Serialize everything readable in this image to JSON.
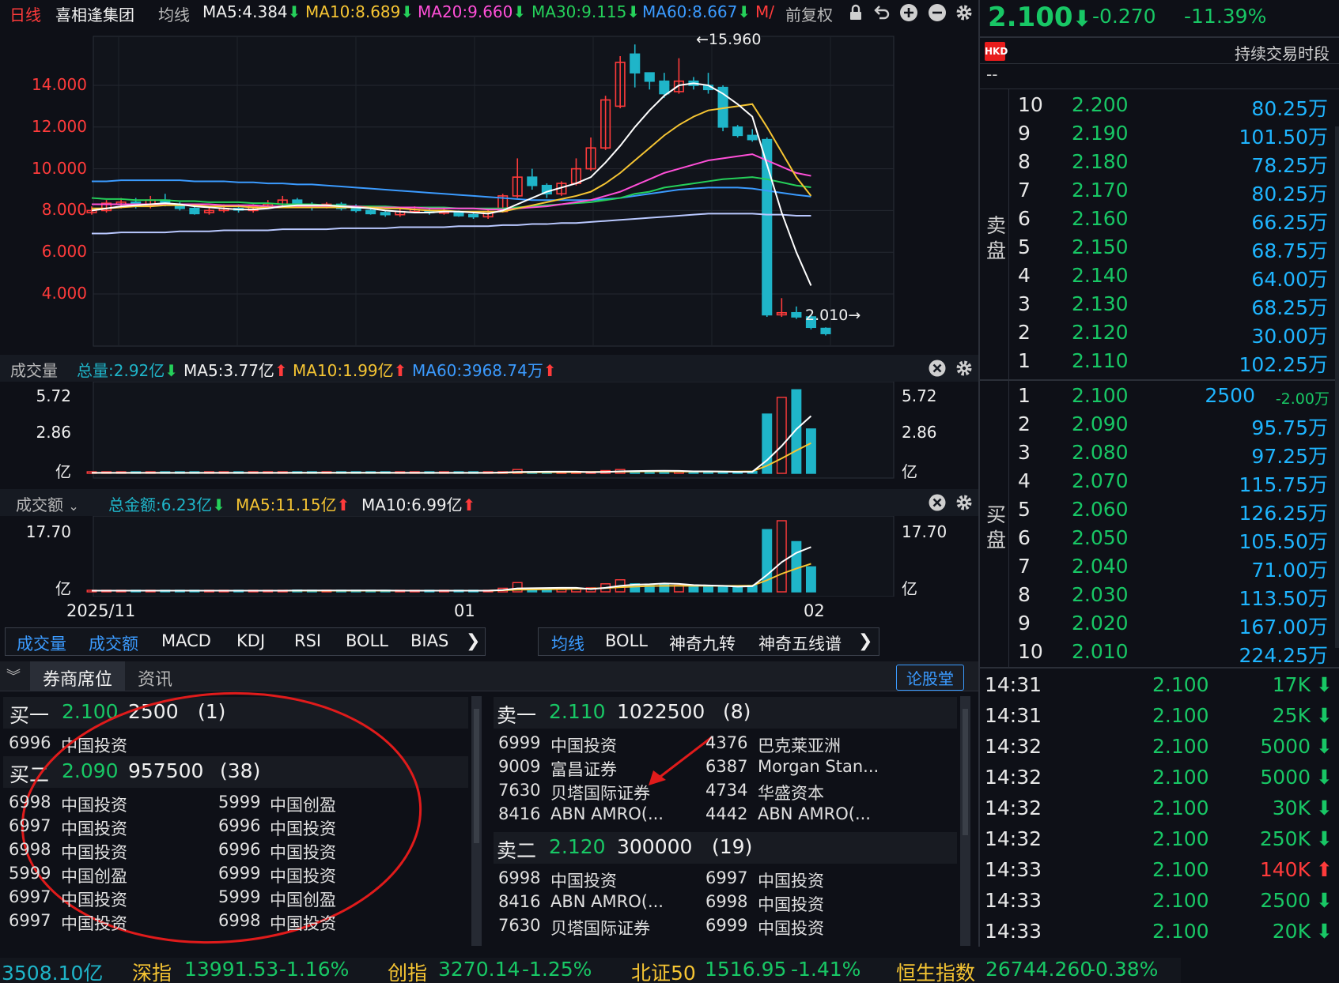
{
  "header": {
    "period": "日线",
    "stock_name": "喜相逢集团",
    "ma_label": "均线",
    "ma5": "MA5:4.384",
    "ma10": "MA10:8.689",
    "ma20": "MA20:9.660",
    "ma30": "MA30:9.115",
    "ma60": "MA60:8.667",
    "ma_more": "M/",
    "adjust": "前复权"
  },
  "quote": {
    "price": "2.100",
    "change": "-0.270",
    "change_pct": "-11.39%",
    "currency_badge": "HKD",
    "session": "持续交易时段",
    "dash": "--"
  },
  "main_chart": {
    "y_ticks": [
      "14.000",
      "12.000",
      "10.000",
      "8.000",
      "6.000",
      "4.000"
    ],
    "high_label": "←15.960",
    "low_label": "2.010→",
    "x_labels": [
      "2025/11",
      "01",
      "02"
    ]
  },
  "chart_data": {
    "type": "candlestick",
    "ylim": [
      1.5,
      16.5
    ],
    "candles": [
      {
        "o": 7.9,
        "c": 8.0,
        "h": 8.2,
        "l": 7.8
      },
      {
        "o": 8.0,
        "c": 8.35,
        "h": 8.5,
        "l": 7.9
      },
      {
        "o": 8.3,
        "c": 8.4,
        "h": 8.6,
        "l": 8.1
      },
      {
        "o": 8.4,
        "c": 8.25,
        "h": 8.6,
        "l": 8.1
      },
      {
        "o": 8.25,
        "c": 8.5,
        "h": 8.7,
        "l": 8.1
      },
      {
        "o": 8.5,
        "c": 8.3,
        "h": 8.8,
        "l": 8.2
      },
      {
        "o": 8.3,
        "c": 8.1,
        "h": 8.4,
        "l": 8.0
      },
      {
        "o": 8.1,
        "c": 7.85,
        "h": 8.2,
        "l": 7.8
      },
      {
        "o": 7.9,
        "c": 8.0,
        "h": 8.2,
        "l": 7.8
      },
      {
        "o": 8.0,
        "c": 8.1,
        "h": 8.3,
        "l": 7.9
      },
      {
        "o": 8.1,
        "c": 8.05,
        "h": 8.3,
        "l": 7.9
      },
      {
        "o": 8.0,
        "c": 8.2,
        "h": 8.3,
        "l": 7.9
      },
      {
        "o": 8.2,
        "c": 8.3,
        "h": 8.5,
        "l": 8.1
      },
      {
        "o": 8.3,
        "c": 8.5,
        "h": 8.7,
        "l": 8.2
      },
      {
        "o": 8.5,
        "c": 8.25,
        "h": 8.6,
        "l": 8.2
      },
      {
        "o": 8.25,
        "c": 8.15,
        "h": 8.4,
        "l": 8.0
      },
      {
        "o": 8.15,
        "c": 8.3,
        "h": 8.4,
        "l": 8.1
      },
      {
        "o": 8.3,
        "c": 8.1,
        "h": 8.4,
        "l": 8.0
      },
      {
        "o": 8.1,
        "c": 8.0,
        "h": 8.3,
        "l": 7.9
      },
      {
        "o": 8.0,
        "c": 7.85,
        "h": 8.1,
        "l": 7.8
      },
      {
        "o": 7.9,
        "c": 7.8,
        "h": 8.0,
        "l": 7.7
      },
      {
        "o": 7.8,
        "c": 7.95,
        "h": 8.1,
        "l": 7.7
      },
      {
        "o": 7.95,
        "c": 8.05,
        "h": 8.2,
        "l": 7.9
      },
      {
        "o": 8.0,
        "c": 7.9,
        "h": 8.1,
        "l": 7.8
      },
      {
        "o": 7.9,
        "c": 7.95,
        "h": 8.1,
        "l": 7.8
      },
      {
        "o": 7.95,
        "c": 7.75,
        "h": 8.0,
        "l": 7.7
      },
      {
        "o": 7.8,
        "c": 7.7,
        "h": 7.9,
        "l": 7.6
      },
      {
        "o": 7.7,
        "c": 7.95,
        "h": 8.1,
        "l": 7.6
      },
      {
        "o": 7.95,
        "c": 8.7,
        "h": 8.8,
        "l": 7.9
      },
      {
        "o": 8.7,
        "c": 9.6,
        "h": 10.5,
        "l": 8.6
      },
      {
        "o": 9.6,
        "c": 9.2,
        "h": 10.0,
        "l": 9.0
      },
      {
        "o": 9.2,
        "c": 8.8,
        "h": 9.3,
        "l": 8.6
      },
      {
        "o": 8.8,
        "c": 9.3,
        "h": 9.4,
        "l": 8.7
      },
      {
        "o": 9.3,
        "c": 10.0,
        "h": 10.5,
        "l": 9.2
      },
      {
        "o": 10.0,
        "c": 11.0,
        "h": 11.5,
        "l": 9.9
      },
      {
        "o": 11.0,
        "c": 13.3,
        "h": 13.5,
        "l": 10.9
      },
      {
        "o": 13.0,
        "c": 15.1,
        "h": 15.4,
        "l": 12.9
      },
      {
        "o": 15.5,
        "c": 14.6,
        "h": 15.96,
        "l": 13.9
      },
      {
        "o": 14.6,
        "c": 14.2,
        "h": 14.6,
        "l": 13.8
      },
      {
        "o": 14.2,
        "c": 13.6,
        "h": 14.6,
        "l": 13.4
      },
      {
        "o": 13.7,
        "c": 14.2,
        "h": 15.3,
        "l": 13.6
      },
      {
        "o": 14.2,
        "c": 14.0,
        "h": 14.4,
        "l": 13.8
      },
      {
        "o": 14.0,
        "c": 13.8,
        "h": 14.6,
        "l": 13.6
      },
      {
        "o": 13.9,
        "c": 12.0,
        "h": 14.0,
        "l": 11.8
      },
      {
        "o": 12.0,
        "c": 11.6,
        "h": 12.1,
        "l": 11.5
      },
      {
        "o": 11.6,
        "c": 11.4,
        "h": 11.9,
        "l": 11.3
      },
      {
        "o": 11.4,
        "c": 3.0,
        "h": 11.5,
        "l": 2.9
      },
      {
        "o": 3.0,
        "c": 3.1,
        "h": 3.8,
        "l": 2.9
      },
      {
        "o": 3.1,
        "c": 2.9,
        "h": 3.4,
        "l": 2.8
      },
      {
        "o": 2.9,
        "c": 2.4,
        "h": 3.0,
        "l": 2.3
      },
      {
        "o": 2.35,
        "c": 2.1,
        "h": 2.4,
        "l": 2.01
      }
    ],
    "ma5": [
      8.0,
      8.1,
      8.2,
      8.25,
      8.3,
      8.35,
      8.3,
      8.2,
      8.15,
      8.1,
      8.05,
      8.05,
      8.1,
      8.2,
      8.25,
      8.25,
      8.25,
      8.2,
      8.15,
      8.1,
      8.0,
      7.95,
      7.9,
      7.9,
      7.95,
      7.95,
      7.9,
      7.85,
      8.0,
      8.3,
      8.6,
      8.9,
      9.1,
      9.3,
      9.6,
      10.3,
      11.1,
      12.0,
      12.8,
      13.5,
      14.0,
      14.1,
      14.0,
      13.6,
      13.1,
      12.5,
      10.2,
      7.9,
      6.0,
      4.4
    ],
    "ma10": [
      8.1,
      8.1,
      8.15,
      8.2,
      8.2,
      8.25,
      8.25,
      8.25,
      8.2,
      8.2,
      8.2,
      8.15,
      8.15,
      8.15,
      8.15,
      8.15,
      8.15,
      8.15,
      8.15,
      8.15,
      8.1,
      8.1,
      8.05,
      8.0,
      8.0,
      7.95,
      7.95,
      7.95,
      7.95,
      8.1,
      8.25,
      8.4,
      8.55,
      8.7,
      8.9,
      9.3,
      9.8,
      10.4,
      11.0,
      11.6,
      12.1,
      12.5,
      12.8,
      12.9,
      13.0,
      13.1,
      12.0,
      10.8,
      9.6,
      8.7
    ],
    "ma20": [
      8.3,
      8.3,
      8.3,
      8.3,
      8.3,
      8.3,
      8.3,
      8.3,
      8.3,
      8.25,
      8.25,
      8.25,
      8.2,
      8.2,
      8.2,
      8.2,
      8.2,
      8.2,
      8.2,
      8.15,
      8.15,
      8.15,
      8.15,
      8.1,
      8.1,
      8.1,
      8.1,
      8.05,
      8.05,
      8.1,
      8.15,
      8.2,
      8.3,
      8.4,
      8.5,
      8.7,
      8.9,
      9.2,
      9.5,
      9.8,
      10.0,
      10.2,
      10.4,
      10.5,
      10.6,
      10.7,
      10.4,
      10.1,
      9.8,
      9.66
    ],
    "ma30": [
      8.6,
      8.55,
      8.55,
      8.5,
      8.5,
      8.5,
      8.45,
      8.45,
      8.4,
      8.4,
      8.4,
      8.35,
      8.35,
      8.3,
      8.3,
      8.3,
      8.25,
      8.25,
      8.2,
      8.2,
      8.2,
      8.15,
      8.15,
      8.15,
      8.15,
      8.1,
      8.1,
      8.1,
      8.1,
      8.15,
      8.2,
      8.25,
      8.3,
      8.35,
      8.4,
      8.5,
      8.6,
      8.8,
      8.9,
      9.1,
      9.2,
      9.3,
      9.4,
      9.5,
      9.55,
      9.6,
      9.5,
      9.35,
      9.2,
      9.115
    ],
    "ma60": [
      9.4,
      9.4,
      9.45,
      9.45,
      9.45,
      9.45,
      9.45,
      9.4,
      9.4,
      9.4,
      9.35,
      9.35,
      9.3,
      9.3,
      9.25,
      9.25,
      9.2,
      9.15,
      9.1,
      9.05,
      9.0,
      8.95,
      8.9,
      8.85,
      8.8,
      8.75,
      8.7,
      8.65,
      8.6,
      8.55,
      8.5,
      8.5,
      8.5,
      8.5,
      8.5,
      8.55,
      8.6,
      8.7,
      8.8,
      8.9,
      9.0,
      9.05,
      9.1,
      9.1,
      9.1,
      9.05,
      8.95,
      8.85,
      8.75,
      8.667
    ],
    "ma120": [
      6.9,
      6.9,
      6.95,
      6.95,
      6.95,
      6.95,
      7.0,
      7.0,
      7.0,
      7.05,
      7.05,
      7.05,
      7.05,
      7.1,
      7.1,
      7.1,
      7.1,
      7.15,
      7.15,
      7.15,
      7.15,
      7.2,
      7.2,
      7.2,
      7.2,
      7.25,
      7.25,
      7.25,
      7.3,
      7.3,
      7.35,
      7.35,
      7.4,
      7.4,
      7.45,
      7.5,
      7.55,
      7.6,
      7.65,
      7.7,
      7.75,
      7.8,
      7.85,
      7.85,
      7.85,
      7.85,
      7.8,
      7.8,
      7.75,
      7.75
    ],
    "volume": [
      0.03,
      0.04,
      0.03,
      0.03,
      0.04,
      0.03,
      0.03,
      0.04,
      0.03,
      0.03,
      0.03,
      0.04,
      0.03,
      0.03,
      0.05,
      0.04,
      0.03,
      0.03,
      0.03,
      0.04,
      0.03,
      0.03,
      0.03,
      0.03,
      0.03,
      0.04,
      0.03,
      0.03,
      0.1,
      0.25,
      0.08,
      0.05,
      0.06,
      0.08,
      0.1,
      0.18,
      0.25,
      0.15,
      0.12,
      0.15,
      0.12,
      0.1,
      0.12,
      0.1,
      0.08,
      0.12,
      3.9,
      5.0,
      5.5,
      2.92
    ],
    "volume_ma5": [
      0.03,
      0.03,
      0.03,
      0.03,
      0.03,
      0.03,
      0.03,
      0.03,
      0.03,
      0.03,
      0.03,
      0.03,
      0.03,
      0.03,
      0.04,
      0.04,
      0.04,
      0.04,
      0.04,
      0.04,
      0.04,
      0.03,
      0.03,
      0.03,
      0.03,
      0.03,
      0.03,
      0.03,
      0.05,
      0.09,
      0.1,
      0.11,
      0.11,
      0.11,
      0.08,
      0.09,
      0.13,
      0.15,
      0.16,
      0.17,
      0.16,
      0.13,
      0.13,
      0.12,
      0.1,
      0.1,
      0.86,
      1.8,
      2.9,
      3.77
    ],
    "volume_ma10": [
      0.03,
      0.03,
      0.03,
      0.03,
      0.03,
      0.03,
      0.03,
      0.03,
      0.03,
      0.03,
      0.03,
      0.03,
      0.03,
      0.03,
      0.03,
      0.03,
      0.03,
      0.03,
      0.03,
      0.03,
      0.03,
      0.03,
      0.03,
      0.03,
      0.03,
      0.03,
      0.03,
      0.03,
      0.04,
      0.06,
      0.07,
      0.07,
      0.08,
      0.08,
      0.09,
      0.1,
      0.11,
      0.12,
      0.13,
      0.13,
      0.12,
      0.12,
      0.12,
      0.12,
      0.12,
      0.13,
      0.5,
      0.98,
      1.5,
      1.99
    ],
    "amount": [
      0.3,
      0.35,
      0.3,
      0.3,
      0.35,
      0.3,
      0.3,
      0.35,
      0.3,
      0.3,
      0.3,
      0.35,
      0.3,
      0.3,
      0.45,
      0.35,
      0.3,
      0.3,
      0.3,
      0.35,
      0.3,
      0.3,
      0.3,
      0.3,
      0.3,
      0.4,
      0.3,
      0.3,
      0.9,
      2.3,
      0.7,
      0.5,
      0.6,
      0.8,
      1.0,
      2.0,
      3.0,
      2.0,
      1.6,
      2.0,
      1.6,
      1.3,
      1.6,
      1.3,
      1.1,
      1.6,
      15.5,
      17.7,
      12.5,
      6.23
    ],
    "amount_ma5": [
      0.3,
      0.3,
      0.3,
      0.3,
      0.3,
      0.3,
      0.3,
      0.3,
      0.3,
      0.3,
      0.3,
      0.3,
      0.3,
      0.3,
      0.35,
      0.35,
      0.35,
      0.35,
      0.35,
      0.35,
      0.35,
      0.3,
      0.3,
      0.3,
      0.3,
      0.3,
      0.3,
      0.3,
      0.45,
      0.85,
      0.9,
      0.95,
      1.0,
      1.0,
      0.7,
      1.0,
      1.5,
      1.8,
      1.9,
      2.1,
      2.0,
      1.7,
      1.6,
      1.5,
      1.3,
      1.4,
      4.2,
      7.4,
      9.7,
      11.15
    ],
    "amount_ma10": [
      0.3,
      0.3,
      0.3,
      0.3,
      0.3,
      0.3,
      0.3,
      0.3,
      0.3,
      0.3,
      0.3,
      0.3,
      0.3,
      0.3,
      0.3,
      0.3,
      0.3,
      0.3,
      0.3,
      0.3,
      0.3,
      0.3,
      0.3,
      0.3,
      0.3,
      0.3,
      0.3,
      0.3,
      0.4,
      0.55,
      0.6,
      0.65,
      0.7,
      0.75,
      0.8,
      0.95,
      1.15,
      1.3,
      1.45,
      1.5,
      1.5,
      1.5,
      1.5,
      1.5,
      1.5,
      1.55,
      2.9,
      4.5,
      5.8,
      6.99
    ]
  },
  "volume_panel": {
    "title": "成交量",
    "total": "总量:2.92亿",
    "ma5": "MA5:3.77亿",
    "ma10": "MA10:1.99亿",
    "ma60": "MA60:3968.74万",
    "y_top": "5.72",
    "y_mid": "2.86",
    "unit": "亿"
  },
  "amount_panel": {
    "title": "成交额",
    "total": "总金额:6.23亿",
    "ma5": "MA5:11.15亿",
    "ma10": "MA10:6.99亿",
    "y_top": "17.70",
    "unit": "亿"
  },
  "indicator_tabs": [
    "成交量",
    "成交额",
    "MACD",
    "KDJ",
    "RSI",
    "BOLL",
    "BIAS"
  ],
  "overlay_tabs": [
    "均线",
    "BOLL",
    "神奇九转",
    "神奇五线谱"
  ],
  "bottom_tabs": {
    "brokers": "券商席位",
    "news": "资讯",
    "forum": "论股堂"
  },
  "broker_buy": {
    "level1": {
      "label": "买一",
      "price": "2.100",
      "volume": "2500",
      "count": "(1)"
    },
    "level1_rows": [
      {
        "code": "6996",
        "name": "中国投资"
      }
    ],
    "level2": {
      "label": "买二",
      "price": "2.090",
      "volume": "957500",
      "count": "(38)"
    },
    "level2_rows": [
      {
        "c1": "6998",
        "n1": "中国投资",
        "c2": "5999",
        "n2": "中国创盈"
      },
      {
        "c1": "6997",
        "n1": "中国投资",
        "c2": "6996",
        "n2": "中国投资"
      },
      {
        "c1": "6998",
        "n1": "中国投资",
        "c2": "6996",
        "n2": "中国投资"
      },
      {
        "c1": "5999",
        "n1": "中国创盈",
        "c2": "6999",
        "n2": "中国投资"
      },
      {
        "c1": "6997",
        "n1": "中国投资",
        "c2": "5999",
        "n2": "中国创盈"
      },
      {
        "c1": "6997",
        "n1": "中国投资",
        "c2": "6998",
        "n2": "中国投资"
      }
    ]
  },
  "broker_sell": {
    "level1": {
      "label": "卖一",
      "price": "2.110",
      "volume": "1022500",
      "count": "(8)"
    },
    "level1_rows": [
      {
        "c1": "6999",
        "n1": "中国投资",
        "c2": "4376",
        "n2": "巴克莱亚洲"
      },
      {
        "c1": "9009",
        "n1": "富昌证券",
        "c2": "6387",
        "n2": "Morgan Stan..."
      },
      {
        "c1": "7630",
        "n1": "贝塔国际证券",
        "c2": "4734",
        "n2": "华盛资本"
      },
      {
        "c1": "8416",
        "n1": "ABN AMRO(...",
        "c2": "4442",
        "n2": "ABN AMRO(..."
      }
    ],
    "level2": {
      "label": "卖二",
      "price": "2.120",
      "volume": "300000",
      "count": "(19)"
    },
    "level2_rows": [
      {
        "c1": "6998",
        "n1": "中国投资",
        "c2": "6997",
        "n2": "中国投资"
      },
      {
        "c1": "8416",
        "n1": "ABN AMRO(...",
        "c2": "6998",
        "n2": "中国投资"
      },
      {
        "c1": "7630",
        "n1": "贝塔国际证券",
        "c2": "6999",
        "n2": "中国投资"
      }
    ]
  },
  "orderbook": {
    "sell_label": [
      "卖",
      "盘"
    ],
    "buy_label": [
      "买",
      "盘"
    ],
    "asks": [
      {
        "lvl": "10",
        "price": "2.200",
        "vol": "80.25万"
      },
      {
        "lvl": "9",
        "price": "2.190",
        "vol": "101.50万"
      },
      {
        "lvl": "8",
        "price": "2.180",
        "vol": "78.25万"
      },
      {
        "lvl": "7",
        "price": "2.170",
        "vol": "80.25万"
      },
      {
        "lvl": "6",
        "price": "2.160",
        "vol": "66.25万"
      },
      {
        "lvl": "5",
        "price": "2.150",
        "vol": "68.75万"
      },
      {
        "lvl": "4",
        "price": "2.140",
        "vol": "64.00万"
      },
      {
        "lvl": "3",
        "price": "2.130",
        "vol": "68.25万"
      },
      {
        "lvl": "2",
        "price": "2.120",
        "vol": "30.00万"
      },
      {
        "lvl": "1",
        "price": "2.110",
        "vol": "102.25万"
      }
    ],
    "bids": [
      {
        "lvl": "1",
        "price": "2.100",
        "vol": "2500",
        "extra": "-2.00万"
      },
      {
        "lvl": "2",
        "price": "2.090",
        "vol": "95.75万"
      },
      {
        "lvl": "3",
        "price": "2.080",
        "vol": "97.25万"
      },
      {
        "lvl": "4",
        "price": "2.070",
        "vol": "115.75万"
      },
      {
        "lvl": "5",
        "price": "2.060",
        "vol": "126.25万"
      },
      {
        "lvl": "6",
        "price": "2.050",
        "vol": "105.50万"
      },
      {
        "lvl": "7",
        "price": "2.040",
        "vol": "71.00万"
      },
      {
        "lvl": "8",
        "price": "2.030",
        "vol": "113.50万"
      },
      {
        "lvl": "9",
        "price": "2.020",
        "vol": "167.00万"
      },
      {
        "lvl": "10",
        "price": "2.010",
        "vol": "224.25万"
      }
    ]
  },
  "ticks": [
    {
      "time": "14:31",
      "price": "2.100",
      "vol": "17K",
      "dir": "down"
    },
    {
      "time": "14:31",
      "price": "2.100",
      "vol": "25K",
      "dir": "down"
    },
    {
      "time": "14:32",
      "price": "2.100",
      "vol": "5000",
      "dir": "down"
    },
    {
      "time": "14:32",
      "price": "2.100",
      "vol": "5000",
      "dir": "down"
    },
    {
      "time": "14:32",
      "price": "2.100",
      "vol": "30K",
      "dir": "down"
    },
    {
      "time": "14:32",
      "price": "2.100",
      "vol": "250K",
      "dir": "down"
    },
    {
      "time": "14:33",
      "price": "2.100",
      "vol": "140K",
      "dir": "up"
    },
    {
      "time": "14:33",
      "price": "2.100",
      "vol": "2500",
      "dir": "down"
    },
    {
      "time": "14:33",
      "price": "2.100",
      "vol": "20K",
      "dir": "down"
    }
  ],
  "status_bar": {
    "turnover": "3508.10亿",
    "sz_name": "深指",
    "sz_val": "13991.53",
    "sz_pct": "-1.16%",
    "cy_name": "创指",
    "cy_val": "3270.14",
    "cy_pct": "-1.25%",
    "bz_name": "北证50",
    "bz_val": "1516.95",
    "bz_pct": "-1.41%",
    "hs_name": "恒生指数",
    "hs_val": "26744.260",
    "hs_pct": "-0.38%"
  },
  "colors": {
    "up": "#ff3b3b",
    "down": "#1fb5c9",
    "ma5": "#ffffff",
    "ma10": "#f6c533",
    "ma20": "#ff4fd8",
    "ma30": "#25d05a",
    "ma60": "#3b9bff",
    "annotation": "#e01b1b"
  }
}
